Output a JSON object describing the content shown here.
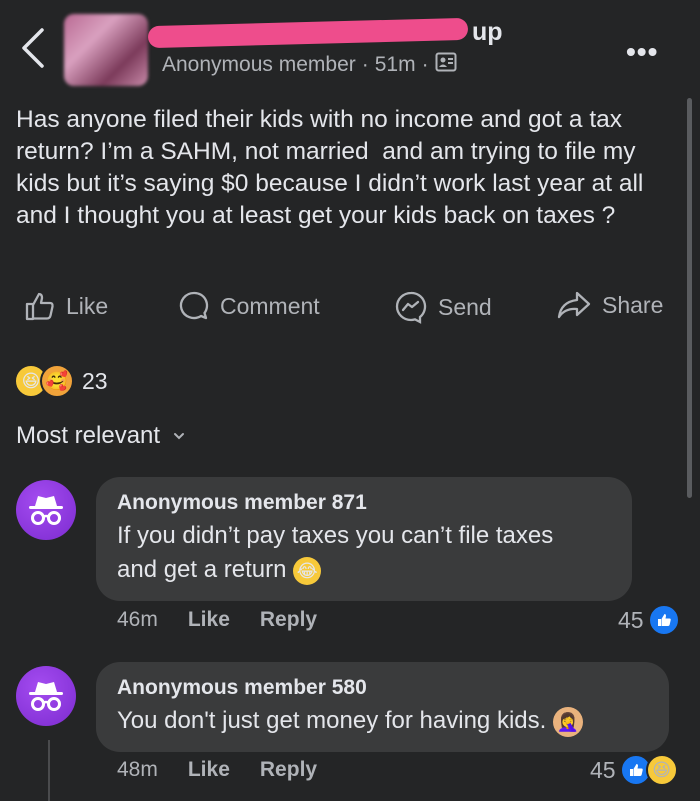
{
  "header": {
    "group_name_visible": "up",
    "author": "Anonymous member",
    "separator": "·",
    "time": "51m",
    "more_label": "•••"
  },
  "post": {
    "text": "Has anyone filed their kids with no income and got a tax return? I’m a SAHM, not married  and am trying to file my kids but it’s saying $0 because I didn’t work last year at all and I thought you at least get your kids back on taxes ?"
  },
  "actions": {
    "like": "Like",
    "comment": "Comment",
    "send": "Send",
    "share": "Share"
  },
  "reactions": {
    "count": "23",
    "icons": [
      "laugh-emoji",
      "care-emoji"
    ]
  },
  "sort": {
    "label": "Most relevant"
  },
  "comments": [
    {
      "author": "Anonymous member 871",
      "text_line1": "If you didn’t pay taxes you can’t file taxes",
      "text_line2": "and get a return",
      "emoji": "laugh-cry-emoji",
      "time": "46m",
      "like": "Like",
      "reply": "Reply",
      "reaction_count": "45"
    },
    {
      "author": "Anonymous member 580",
      "text": "You don't just get money for having kids.",
      "emoji": "facepalm-emoji",
      "time": "48m",
      "like": "Like",
      "reply": "Reply",
      "reaction_count": "45"
    }
  ],
  "colors": {
    "background": "#242526",
    "bubble": "#3a3b3c",
    "text": "#e4e6eb",
    "muted": "#b0b3b8",
    "accent_blue": "#1877f2",
    "avatar_purple": "#8a34d8",
    "redaction_pink": "#ee4d8c"
  }
}
